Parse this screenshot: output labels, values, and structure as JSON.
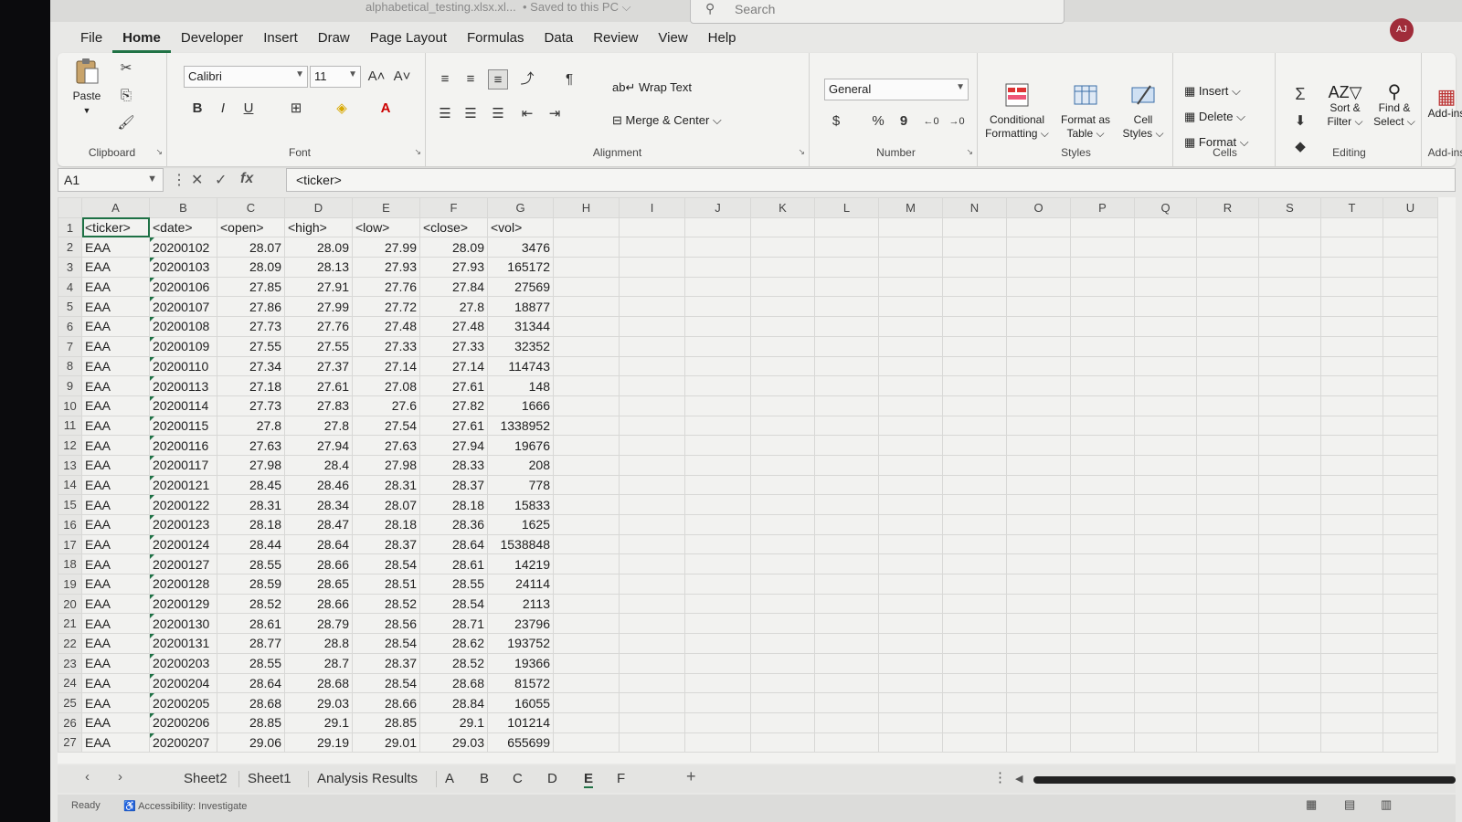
{
  "titlebar": {
    "doc_name": "alphabetical_testing.xlsx.xl...",
    "saved": "• Saved to this PC ⌵",
    "search_placeholder": "Search",
    "avatar": "AJ"
  },
  "menu": [
    "File",
    "Home",
    "Developer",
    "Insert",
    "Draw",
    "Page Layout",
    "Formulas",
    "Data",
    "Review",
    "View",
    "Help"
  ],
  "ribbon": {
    "clipboard": {
      "paste": "Paste",
      "label": "Clipboard"
    },
    "font": {
      "name": "Calibri",
      "size": "11",
      "bold": "B",
      "italic": "I",
      "underline": "U",
      "label": "Font"
    },
    "alignment": {
      "wrap": "Wrap Text",
      "merge": "Merge & Center",
      "label": "Alignment"
    },
    "number": {
      "format": "General",
      "currency": "$",
      "percent": "%",
      "comma": "9",
      "label": "Number"
    },
    "styles": {
      "conditional": "Conditional",
      "conditional2": "Formatting",
      "format_table": "Format as",
      "format_table2": "Table",
      "cell_styles": "Cell",
      "cell_styles2": "Styles",
      "label": "Styles"
    },
    "cells": {
      "insert": "Insert",
      "delete": "Delete",
      "format": "Format",
      "label": "Cells"
    },
    "editing": {
      "sort": "Sort &",
      "sort2": "Filter",
      "find": "Find &",
      "find2": "Select",
      "label": "Editing"
    },
    "addins": {
      "addins": "Add-ins",
      "label": "Add-ins"
    }
  },
  "formula_bar": {
    "name_box": "A1",
    "formula": "<ticker>"
  },
  "columns": [
    "A",
    "B",
    "C",
    "D",
    "E",
    "F",
    "G",
    "H",
    "I",
    "J",
    "K",
    "L",
    "M",
    "N",
    "O",
    "P",
    "Q",
    "R",
    "S",
    "T",
    "U"
  ],
  "header_row": [
    "<ticker>",
    "<date>",
    "<open>",
    "<high>",
    "<low>",
    "<close>",
    "<vol>"
  ],
  "rows": [
    [
      "EAA",
      "20200102",
      "28.07",
      "28.09",
      "27.99",
      "28.09",
      "3476"
    ],
    [
      "EAA",
      "20200103",
      "28.09",
      "28.13",
      "27.93",
      "27.93",
      "165172"
    ],
    [
      "EAA",
      "20200106",
      "27.85",
      "27.91",
      "27.76",
      "27.84",
      "27569"
    ],
    [
      "EAA",
      "20200107",
      "27.86",
      "27.99",
      "27.72",
      "27.8",
      "18877"
    ],
    [
      "EAA",
      "20200108",
      "27.73",
      "27.76",
      "27.48",
      "27.48",
      "31344"
    ],
    [
      "EAA",
      "20200109",
      "27.55",
      "27.55",
      "27.33",
      "27.33",
      "32352"
    ],
    [
      "EAA",
      "20200110",
      "27.34",
      "27.37",
      "27.14",
      "27.14",
      "114743"
    ],
    [
      "EAA",
      "20200113",
      "27.18",
      "27.61",
      "27.08",
      "27.61",
      "148"
    ],
    [
      "EAA",
      "20200114",
      "27.73",
      "27.83",
      "27.6",
      "27.82",
      "1666"
    ],
    [
      "EAA",
      "20200115",
      "27.8",
      "27.8",
      "27.54",
      "27.61",
      "1338952"
    ],
    [
      "EAA",
      "20200116",
      "27.63",
      "27.94",
      "27.63",
      "27.94",
      "19676"
    ],
    [
      "EAA",
      "20200117",
      "27.98",
      "28.4",
      "27.98",
      "28.33",
      "208"
    ],
    [
      "EAA",
      "20200121",
      "28.45",
      "28.46",
      "28.31",
      "28.37",
      "778"
    ],
    [
      "EAA",
      "20200122",
      "28.31",
      "28.34",
      "28.07",
      "28.18",
      "15833"
    ],
    [
      "EAA",
      "20200123",
      "28.18",
      "28.47",
      "28.18",
      "28.36",
      "1625"
    ],
    [
      "EAA",
      "20200124",
      "28.44",
      "28.64",
      "28.37",
      "28.64",
      "1538848"
    ],
    [
      "EAA",
      "20200127",
      "28.55",
      "28.66",
      "28.54",
      "28.61",
      "14219"
    ],
    [
      "EAA",
      "20200128",
      "28.59",
      "28.65",
      "28.51",
      "28.55",
      "24114"
    ],
    [
      "EAA",
      "20200129",
      "28.52",
      "28.66",
      "28.52",
      "28.54",
      "2113"
    ],
    [
      "EAA",
      "20200130",
      "28.61",
      "28.79",
      "28.56",
      "28.71",
      "23796"
    ],
    [
      "EAA",
      "20200131",
      "28.77",
      "28.8",
      "28.54",
      "28.62",
      "193752"
    ],
    [
      "EAA",
      "20200203",
      "28.55",
      "28.7",
      "28.37",
      "28.52",
      "19366"
    ],
    [
      "EAA",
      "20200204",
      "28.64",
      "28.68",
      "28.54",
      "28.68",
      "81572"
    ],
    [
      "EAA",
      "20200205",
      "28.68",
      "29.03",
      "28.66",
      "28.84",
      "16055"
    ],
    [
      "EAA",
      "20200206",
      "28.85",
      "29.1",
      "28.85",
      "29.1",
      "101214"
    ],
    [
      "EAA",
      "20200207",
      "29.06",
      "29.19",
      "29.01",
      "29.03",
      "655699"
    ]
  ],
  "sheet_tabs": [
    "Sheet2",
    "Sheet1",
    "Analysis Results",
    "A",
    "B",
    "C",
    "D",
    "E",
    "F"
  ],
  "active_sheet": "E",
  "status": {
    "ready": "Ready",
    "accessibility": "Accessibility: Investigate"
  },
  "colors": {
    "accent": "#217346",
    "avatar": "#a02c3a"
  }
}
